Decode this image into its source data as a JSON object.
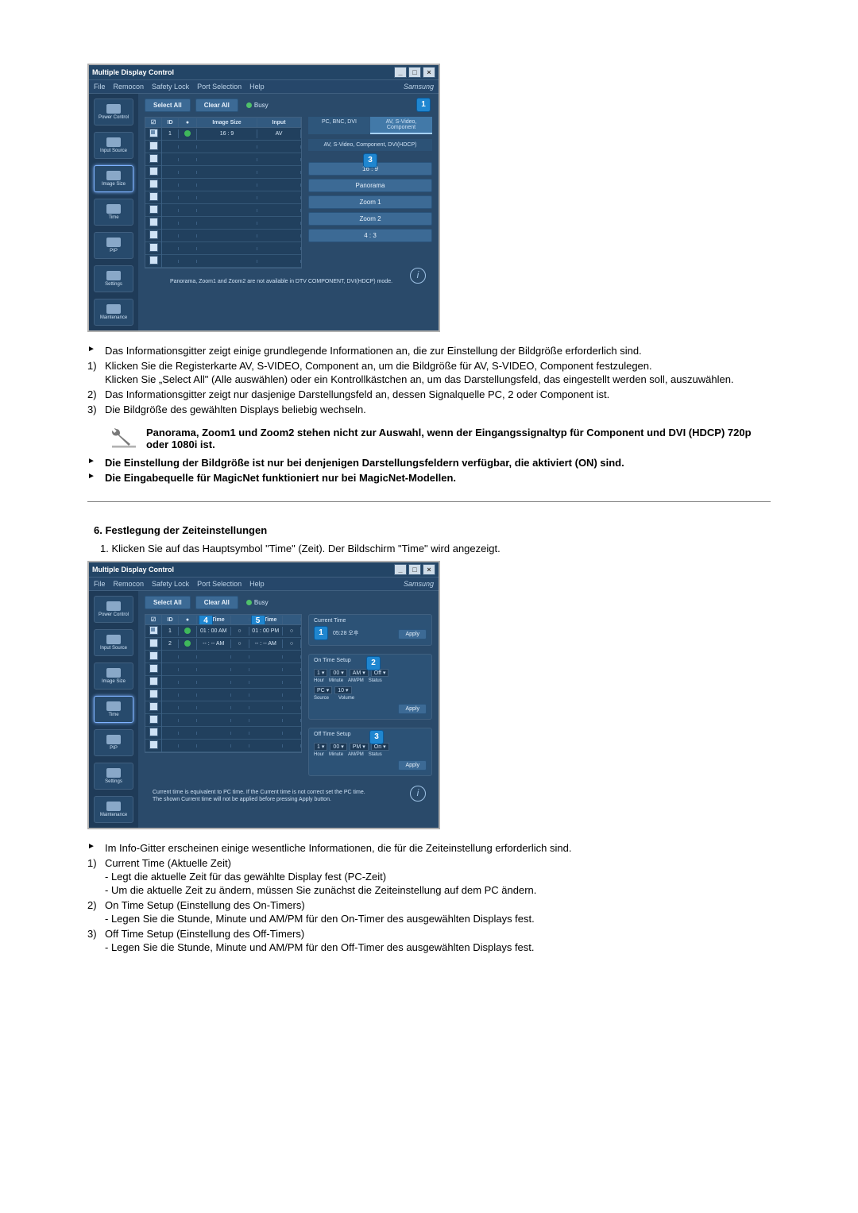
{
  "app": {
    "title": "Multiple Display Control",
    "brand": "Samsung",
    "menu": {
      "file": "File",
      "remocon": "Remocon",
      "safety": "Safety Lock",
      "port": "Port Selection",
      "help": "Help"
    },
    "toolbar": {
      "select_all": "Select All",
      "clear_all": "Clear All",
      "busy": "Busy"
    },
    "sidebar": {
      "power": "Power Control",
      "input": "Input Source",
      "image_size": "Image Size",
      "time": "Time",
      "pip": "PIP",
      "settings": "Settings",
      "maintenance": "Maintenance"
    },
    "grid1": {
      "head_id": "ID",
      "head_col3": "",
      "head_image_size": "Image Size",
      "head_input": "Input",
      "row1_id": "1",
      "row1_size": "16 : 9",
      "row1_input": "AV"
    },
    "tabs1": {
      "pc": "PC, BNC, DVI",
      "av": "AV, S-Video, Component"
    },
    "tabs2_label": "AV, S-Video, Component, DVI(HDCP)",
    "opts": {
      "o169": "16 : 9",
      "panorama": "Panorama",
      "zoom1": "Zoom 1",
      "zoom2": "Zoom 2",
      "o43": "4 : 3"
    },
    "footer1": "Panorama, Zoom1 and Zoom2 are not available in DTV COMPONENT, DVI(HDCP) mode.",
    "grid2": {
      "head_ontime": "On Time",
      "head_offtime": "Off Time",
      "row1_ontime_h": "01",
      "row1_ontime_m": "00",
      "row1_ontime_ampm": "AM",
      "row1_offtime_h": "01",
      "row1_offtime_m": "00",
      "row1_offtime_ampm": "PM",
      "row2_am": "AM",
      "row2_am2": "AM"
    },
    "time_panel": {
      "current": "Current Time",
      "current_val": "05:28 오후",
      "apply": "Apply",
      "on_label": "On Time Setup",
      "off_label": "Off Time Setup",
      "am": "AM",
      "pm": "PM",
      "off": "Off",
      "on": "On",
      "hour_lbl": "Hour",
      "minute_lbl": "Minute",
      "ampm_lbl": "AM/PM",
      "status_lbl": "Status",
      "source_lbl": "Source",
      "volume_lbl": "Volume",
      "pc": "PC",
      "vol": "10",
      "h_1": "1",
      "m_00": "00"
    },
    "footer2a": "Current time is equivalent to PC time. If the Current time is not correct set the PC time.",
    "footer2b": "The shown Current time will not be applied before pressing Apply button."
  },
  "doc": {
    "imgsize_bullet1": "Das Informationsgitter zeigt einige grundlegende Informationen an, die zur Einstellung der Bildgröße erforderlich sind.",
    "imgsize_1a": "Klicken Sie die Registerkarte AV, S-VIDEO, Component an, um die Bildgröße für AV, S-VIDEO, Component festzulegen.",
    "imgsize_1b": "Klicken Sie „Select All\" (Alle auswählen) oder ein Kontrollkästchen an, um das Darstellungsfeld, das eingestellt werden soll, auszuwählen.",
    "imgsize_2": "Das Informationsgitter zeigt nur dasjenige Darstellungsfeld an, dessen Signalquelle PC, 2 oder Component ist.",
    "imgsize_3": "Die Bildgröße des gewählten Displays beliebig wechseln.",
    "imgsize_warn": "Panorama, Zoom1 und Zoom2 stehen nicht zur Auswahl, wenn der Eingangssignaltyp für Component und DVI (HDCP) 720p oder 1080i ist.",
    "imgsize_bullet2": "Die Einstellung der Bildgröße ist nur bei denjenigen Darstellungsfeldern verfügbar, die aktiviert (ON) sind.",
    "imgsize_bullet3": "Die Eingabequelle für MagicNet funktioniert nur bei MagicNet-Modellen.",
    "sec6_title": "6. Festlegung der Zeiteinstellungen",
    "sec6_step1": "1.  Klicken Sie auf das Hauptsymbol \"Time\" (Zeit). Der Bildschirm \"Time\" wird angezeigt.",
    "time_bullet1": "Im Info-Gitter erscheinen einige wesentliche Informationen, die für die Zeiteinstellung erforderlich sind.",
    "time_1": "Current Time (Aktuelle Zeit)",
    "time_1a": "- Legt die aktuelle Zeit für das gewählte Display fest (PC-Zeit)",
    "time_1b": "- Um die aktuelle Zeit zu ändern, müssen Sie zunächst die Zeiteinstellung auf dem PC ändern.",
    "time_2": "On Time Setup (Einstellung des On-Timers)",
    "time_2a": "- Legen Sie die Stunde, Minute und AM/PM für den On-Timer des ausgewählten Displays fest.",
    "time_3": "Off Time Setup (Einstellung des Off-Timers)",
    "time_3a": "- Legen Sie die Stunde, Minute und AM/PM für den Off-Timer des ausgewählten Displays fest."
  }
}
